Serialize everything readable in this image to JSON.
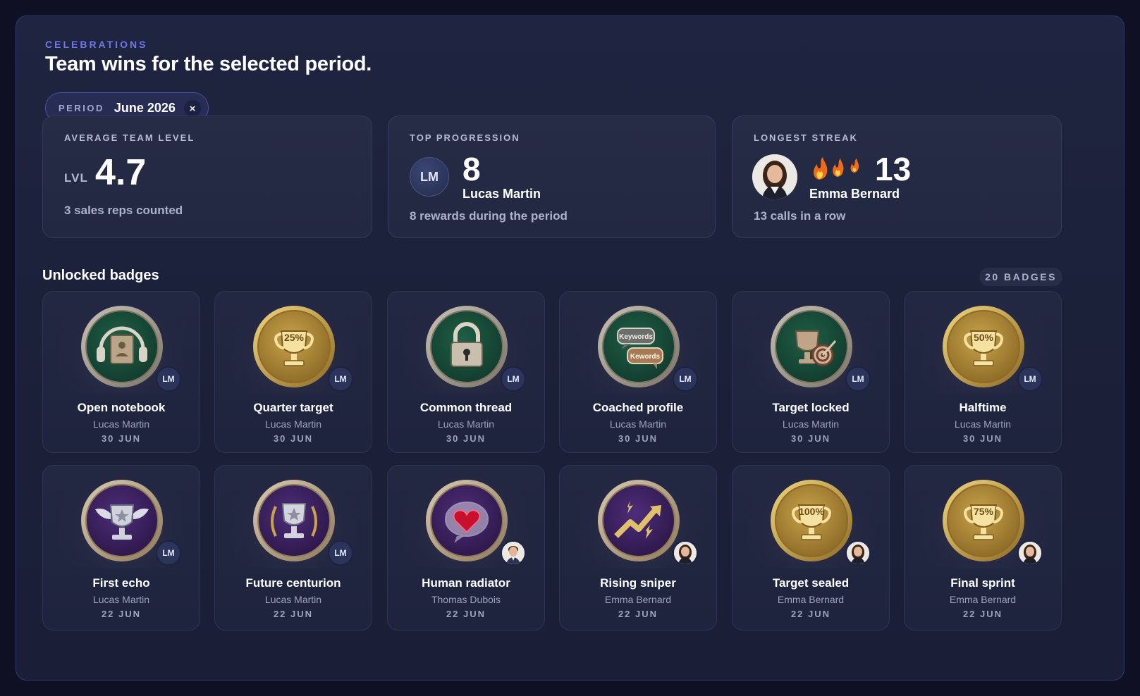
{
  "header": {
    "eyebrow": "CELEBRATIONS",
    "title": "Team wins for the selected period."
  },
  "filter": {
    "label": "PERIOD",
    "value": "June 2026",
    "clear_icon": "×"
  },
  "stats": {
    "average_level": {
      "label": "AVERAGE TEAM LEVEL",
      "prefix": "LVL",
      "value": "4.7",
      "sub": "3 sales reps counted"
    },
    "top_progression": {
      "label": "TOP PROGRESSION",
      "initials": "LM",
      "value": "8",
      "name": "Lucas Martin",
      "sub": "8 rewards during the period"
    },
    "longest_streak": {
      "label": "LONGEST STREAK",
      "flame_icon": "fire-icon",
      "value": "13",
      "name": "Emma Bernard",
      "sub": "13 calls in a row"
    }
  },
  "badges_section": {
    "title": "Unlocked badges",
    "count": "20 BADGES",
    "items": [
      {
        "name": "Open notebook",
        "owner": "Lucas Martin",
        "date": "30 JUN",
        "initials": "LM",
        "style": "green",
        "icon": "headphones-notebook-icon"
      },
      {
        "name": "Quarter target",
        "owner": "Lucas Martin",
        "date": "30 JUN",
        "initials": "LM",
        "style": "gold",
        "icon": "trophy-flag-icon",
        "medal_text": "25%"
      },
      {
        "name": "Common thread",
        "owner": "Lucas Martin",
        "date": "30 JUN",
        "initials": "LM",
        "style": "green",
        "icon": "padlock-icon"
      },
      {
        "name": "Coached profile",
        "owner": "Lucas Martin",
        "date": "30 JUN",
        "initials": "LM",
        "style": "green",
        "icon": "speech-bubbles-icon",
        "medal_text": "Keywords",
        "medal_text2": "Kewords"
      },
      {
        "name": "Target locked",
        "owner": "Lucas Martin",
        "date": "30 JUN",
        "initials": "LM",
        "style": "green",
        "icon": "trophy-target-icon"
      },
      {
        "name": "Halftime",
        "owner": "Lucas Martin",
        "date": "30 JUN",
        "initials": "LM",
        "style": "gold",
        "icon": "trophy-progress-icon",
        "medal_text": "50%"
      },
      {
        "name": "First echo",
        "owner": "Lucas Martin",
        "date": "22 JUN",
        "initials": "LM",
        "style": "purple",
        "icon": "winged-trophy-icon"
      },
      {
        "name": "Future centurion",
        "owner": "Lucas Martin",
        "date": "22 JUN",
        "initials": "LM",
        "style": "purple",
        "icon": "laurel-trophy-icon"
      },
      {
        "name": "Human radiator",
        "owner": "Thomas Dubois",
        "date": "22 JUN",
        "initials": "",
        "style": "purple",
        "icon": "heart-bubble-icon",
        "owner_avatar": "male-photo"
      },
      {
        "name": "Rising sniper",
        "owner": "Emma Bernard",
        "date": "22 JUN",
        "initials": "",
        "style": "purple",
        "icon": "rising-arrow-icon",
        "owner_avatar": "female-photo"
      },
      {
        "name": "Target sealed",
        "owner": "Emma Bernard",
        "date": "22 JUN",
        "initials": "",
        "style": "gold",
        "icon": "trophy-ribbon-icon",
        "medal_text": "100%",
        "owner_avatar": "female-photo"
      },
      {
        "name": "Final sprint",
        "owner": "Emma Bernard",
        "date": "22 JUN",
        "initials": "",
        "style": "gold",
        "icon": "trophy-speed-icon",
        "medal_text": "75%",
        "owner_avatar": "female-photo"
      }
    ]
  },
  "colors": {
    "background": "#0f1024",
    "accent": "#6f78e8",
    "medal_green": "#1f5e47",
    "medal_gold": "#c9a24a",
    "medal_purple": "#4e2d7a"
  }
}
